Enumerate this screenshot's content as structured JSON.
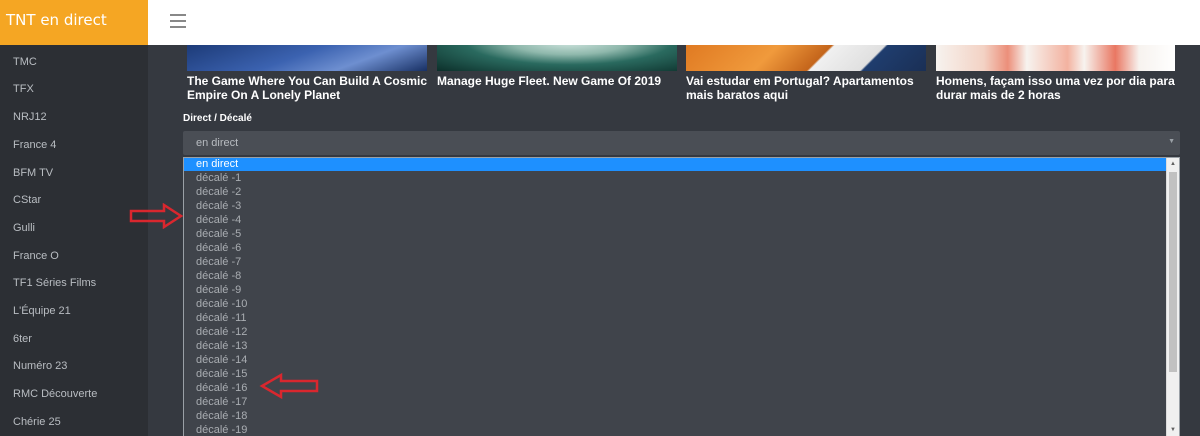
{
  "app": {
    "title": "TNT en direct"
  },
  "header": {
    "menu_icon": "hamburger-menu-icon"
  },
  "sidebar": {
    "items": [
      {
        "label": "TMC"
      },
      {
        "label": "TFX"
      },
      {
        "label": "NRJ12"
      },
      {
        "label": "France 4"
      },
      {
        "label": "BFM TV"
      },
      {
        "label": "CStar"
      },
      {
        "label": "Gulli"
      },
      {
        "label": "France O"
      },
      {
        "label": "TF1 Séries Films"
      },
      {
        "label": "L'Équipe 21"
      },
      {
        "label": "6ter"
      },
      {
        "label": "Numéro 23"
      },
      {
        "label": "RMC Découverte"
      },
      {
        "label": "Chérie 25"
      }
    ]
  },
  "cards": [
    {
      "title": "The Game Where You Can Build A Cosmic Empire On A Lonely Planet"
    },
    {
      "title": "Manage Huge Fleet. New Game Of 2019"
    },
    {
      "title": "Vai estudar em Portugal? Apartamentos mais baratos aqui"
    },
    {
      "title": "Homens, façam isso uma vez por dia para durar mais de 2 horas"
    }
  ],
  "form": {
    "label": "Direct / Décalé",
    "selected_value": "en direct",
    "options": [
      {
        "label": "en direct",
        "selected": true
      },
      {
        "label": "décalé -1"
      },
      {
        "label": "décalé -2"
      },
      {
        "label": "décalé -3"
      },
      {
        "label": "décalé -4"
      },
      {
        "label": "décalé -5"
      },
      {
        "label": "décalé -6"
      },
      {
        "label": "décalé -7"
      },
      {
        "label": "décalé -8"
      },
      {
        "label": "décalé -9"
      },
      {
        "label": "décalé -10"
      },
      {
        "label": "décalé -11"
      },
      {
        "label": "décalé -12"
      },
      {
        "label": "décalé -13"
      },
      {
        "label": "décalé -14"
      },
      {
        "label": "décalé -15"
      },
      {
        "label": "décalé -16"
      },
      {
        "label": "décalé -17"
      },
      {
        "label": "décalé -18"
      },
      {
        "label": "décalé -19"
      }
    ]
  },
  "colors": {
    "brand": "#f5a623",
    "selected_option": "#1e90ff",
    "annotation_arrow": "#d9272e"
  }
}
